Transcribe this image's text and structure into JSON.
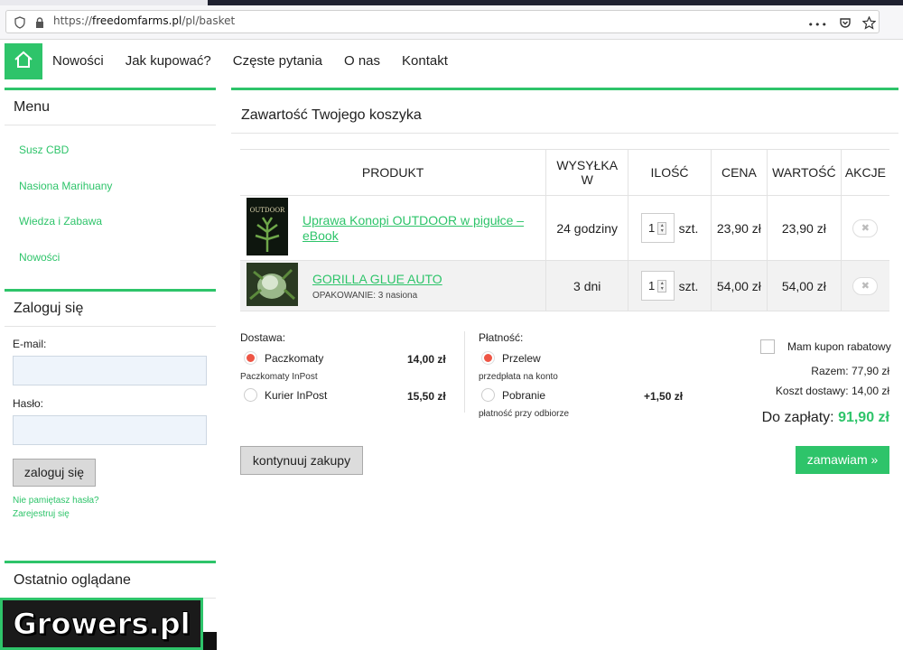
{
  "browser": {
    "url_prefix": "https://",
    "url_domain": "freedomfarms.pl",
    "url_path": "/pl/basket",
    "menu_dots": "•••"
  },
  "nav": {
    "items": [
      "Nowości",
      "Jak kupować?",
      "Częste pytania",
      "O nas",
      "Kontakt"
    ]
  },
  "sidebar": {
    "menu_title": "Menu",
    "menu_items": [
      "Susz CBD",
      "Nasiona Marihuany",
      "Wiedza i Zabawa",
      "Nowości"
    ],
    "login_title": "Zaloguj się",
    "email_label": "E-mail:",
    "password_label": "Hasło:",
    "login_button": "zaloguj się",
    "forgot_link": "Nie pamiętasz hasła?",
    "register_link": "Zarejestruj się",
    "recent_title": "Ostatnio oglądane"
  },
  "cart": {
    "title": "Zawartość Twojego koszyka",
    "headers": [
      "PRODUKT",
      "WYSYŁKA W",
      "ILOŚĆ",
      "CENA",
      "WARTOŚĆ",
      "AKCJE"
    ],
    "rows": [
      {
        "name": "Uprawa Konopi OUTDOOR w pigułce – eBook",
        "meta": "",
        "shipping": "24 godziny",
        "qty": "1",
        "unit": "szt.",
        "price": "23,90 zł",
        "value": "23,90 zł",
        "thumb_text": "OUTDOOR"
      },
      {
        "name": "GORILLA GLUE AUTO",
        "meta": "OPAKOWANIE: 3 nasiona",
        "shipping": "3 dni",
        "qty": "1",
        "unit": "szt.",
        "price": "54,00 zł",
        "value": "54,00 zł",
        "thumb_text": ""
      }
    ],
    "remove_symbol": "✖"
  },
  "delivery": {
    "label": "Dostawa:",
    "options": [
      {
        "name": "Paczkomaty",
        "sub": "Paczkomaty InPost",
        "price": "14,00 zł",
        "selected": true
      },
      {
        "name": "Kurier InPost",
        "sub": "",
        "price": "15,50 zł",
        "selected": false
      }
    ]
  },
  "payment": {
    "label": "Płatność:",
    "options": [
      {
        "name": "Przelew",
        "sub": "przedpłata na konto",
        "price": "",
        "selected": true
      },
      {
        "name": "Pobranie",
        "sub": "płatność przy odbiorze",
        "price": "+1,50 zł",
        "selected": false
      }
    ]
  },
  "summary": {
    "coupon_label": "Mam kupon rabatowy",
    "subtotal_label": "Razem:",
    "subtotal": "77,90 zł",
    "shipping_label": "Koszt dostawy:",
    "shipping": "14,00 zł",
    "total_label": "Do zapłaty:",
    "total": "91,90 zł"
  },
  "buttons": {
    "continue": "kontynuuj zakupy",
    "order": "zamawiam »"
  },
  "watermark": "Growers.pl",
  "colors": {
    "accent": "#2ec46a",
    "radio_selected": "#ee5545"
  }
}
